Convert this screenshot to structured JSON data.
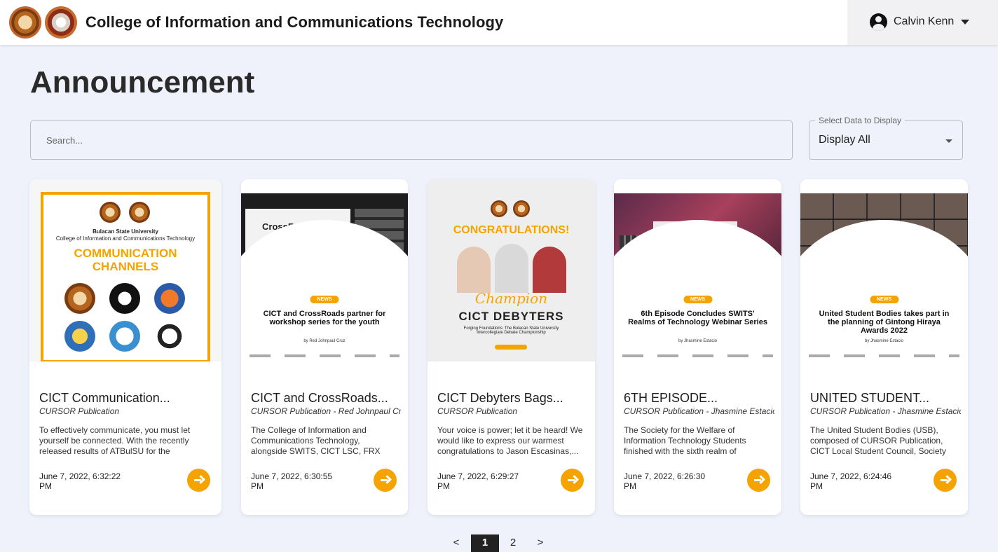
{
  "header": {
    "title": "College of Information and Communications Technology",
    "user_name": "Calvin Kenn",
    "logos": [
      "bulsu-logo",
      "cict-logo"
    ]
  },
  "page": {
    "title": "Announcement"
  },
  "search": {
    "placeholder": "Search..."
  },
  "filter": {
    "label": "Select Data to Display",
    "value": "Display All"
  },
  "cards": [
    {
      "title": "CICT Communication...",
      "author": "CURSOR Publication",
      "excerpt": "To effectively communicate, you must let yourself be connected. With the recently released results of ATBulSU for the Academic...",
      "date": "June 7, 2022, 6:32:22 PM",
      "thumb": {
        "school": "Bulacan State University",
        "college": "College of Information and Communications Technology",
        "headline": "COMMUNICATION CHANNELS"
      }
    },
    {
      "title": "CICT and CrossRoads...",
      "author": "CURSOR Publication - Red Johnpaul Cruz",
      "excerpt": "The College of Information and Communications Technology, alongside SWITS, CICT LSC, FRX Crew, BLISS Org,...",
      "date": "June 7, 2022, 6:30:55 PM",
      "thumb": {
        "brand": "CrossRoads",
        "tag": "NEWS",
        "headline": "CICT and CrossRoads partner for workshop series for the youth",
        "by": "by Red Johnpaul Cruz"
      }
    },
    {
      "title": "CICT Debyters Bags...",
      "author": "CURSOR Publication",
      "excerpt": "Your voice is power; let it be heard! We would like to express our warmest congratulations to Jason Escasinas,...",
      "date": "June 7, 2022, 6:29:27 PM",
      "thumb": {
        "headline": "CONGRATULATIONS!",
        "team": "CICT DEBYTERS",
        "script": "Champion",
        "sub": "Forging Foundations: The Bulacan State University Intercollegiate Debate Championship"
      }
    },
    {
      "title": "6TH EPISODE...",
      "author": "CURSOR Publication - Jhasmine Estacio",
      "excerpt": "The Society for the Welfare of Information Technology Students finished with the sixth realm of Technology Webinar,...",
      "date": "June 7, 2022, 6:26:30 PM",
      "thumb": {
        "tag": "NEWS",
        "headline": "6th Episode Concludes SWITS' Realms of Technology Webinar Series",
        "by": "by Jhasmine Estacio"
      }
    },
    {
      "title": "UNITED STUDENT...",
      "author": "CURSOR Publication - Jhasmine Estacio",
      "excerpt": "The United Student Bodies (USB), composed of CURSOR Publication, CICT Local Student Council, Society for the...",
      "date": "June 7, 2022, 6:24:46 PM",
      "thumb": {
        "tag": "NEWS",
        "headline": "United Student Bodies takes part in the planning of Gintong Hiraya Awards 2022",
        "by": "by Jhasmine Estacio"
      }
    }
  ],
  "pagination": {
    "prev": "<",
    "pages": [
      "1",
      "2"
    ],
    "current": "1",
    "next": ">"
  },
  "colors": {
    "accent": "#f5a300",
    "background": "#eff2fb",
    "active_page": "#222222"
  }
}
